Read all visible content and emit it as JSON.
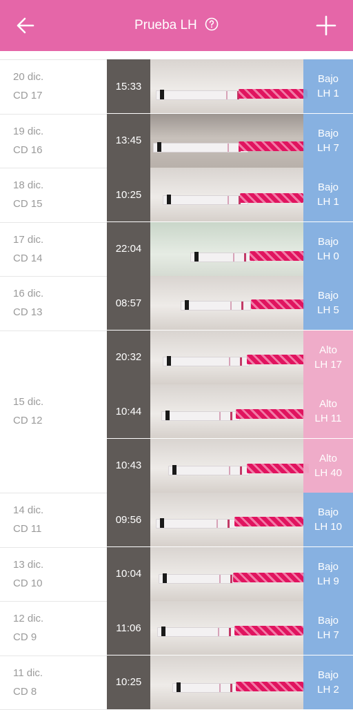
{
  "header": {
    "title": "Prueba LH",
    "background": "#e566a8",
    "back_icon": "arrow-left-icon",
    "help_icon": "help-circle-icon",
    "add_icon": "plus-icon"
  },
  "colors": {
    "low": "#7daade",
    "high": "#eea8c6",
    "time_bg": "#5f5a57"
  },
  "dates": [
    {
      "date": "20 dic.",
      "cd": "CD 17"
    },
    {
      "date": "19 dic.",
      "cd": "CD 16"
    },
    {
      "date": "18 dic.",
      "cd": "CD 15"
    },
    {
      "date": "17 dic.",
      "cd": "CD 14"
    },
    {
      "date": "16 dic.",
      "cd": "CD 13"
    },
    {
      "date": "15 dic.",
      "cd": "CD 12"
    },
    {
      "date": "14 dic.",
      "cd": "CD 11"
    },
    {
      "date": "13 dic.",
      "cd": "CD 10"
    },
    {
      "date": "12 dic.",
      "cd": "CD 9"
    },
    {
      "date": "11 dic.",
      "cd": "CD 8"
    }
  ],
  "entries": [
    {
      "time": "15:33",
      "level": "Bajo",
      "lh": "LH 1",
      "status": "low"
    },
    {
      "time": "13:45",
      "level": "Bajo",
      "lh": "LH 7",
      "status": "low"
    },
    {
      "time": "10:25",
      "level": "Bajo",
      "lh": "LH 1",
      "status": "low"
    },
    {
      "time": "22:04",
      "level": "Bajo",
      "lh": "LH 0",
      "status": "low"
    },
    {
      "time": "08:57",
      "level": "Bajo",
      "lh": "LH 5",
      "status": "low"
    },
    {
      "time": "20:32",
      "level": "Alto",
      "lh": "LH 17",
      "status": "high"
    },
    {
      "time": "10:44",
      "level": "Alto",
      "lh": "LH 11",
      "status": "high"
    },
    {
      "time": "10:43",
      "level": "Alto",
      "lh": "LH 40",
      "status": "high"
    },
    {
      "time": "09:56",
      "level": "Bajo",
      "lh": "LH 10",
      "status": "low"
    },
    {
      "time": "10:04",
      "level": "Bajo",
      "lh": "LH 9",
      "status": "low"
    },
    {
      "time": "11:06",
      "level": "Bajo",
      "lh": "LH 7",
      "status": "low"
    },
    {
      "time": "10:25",
      "level": "Bajo",
      "lh": "LH 2",
      "status": "low"
    }
  ]
}
